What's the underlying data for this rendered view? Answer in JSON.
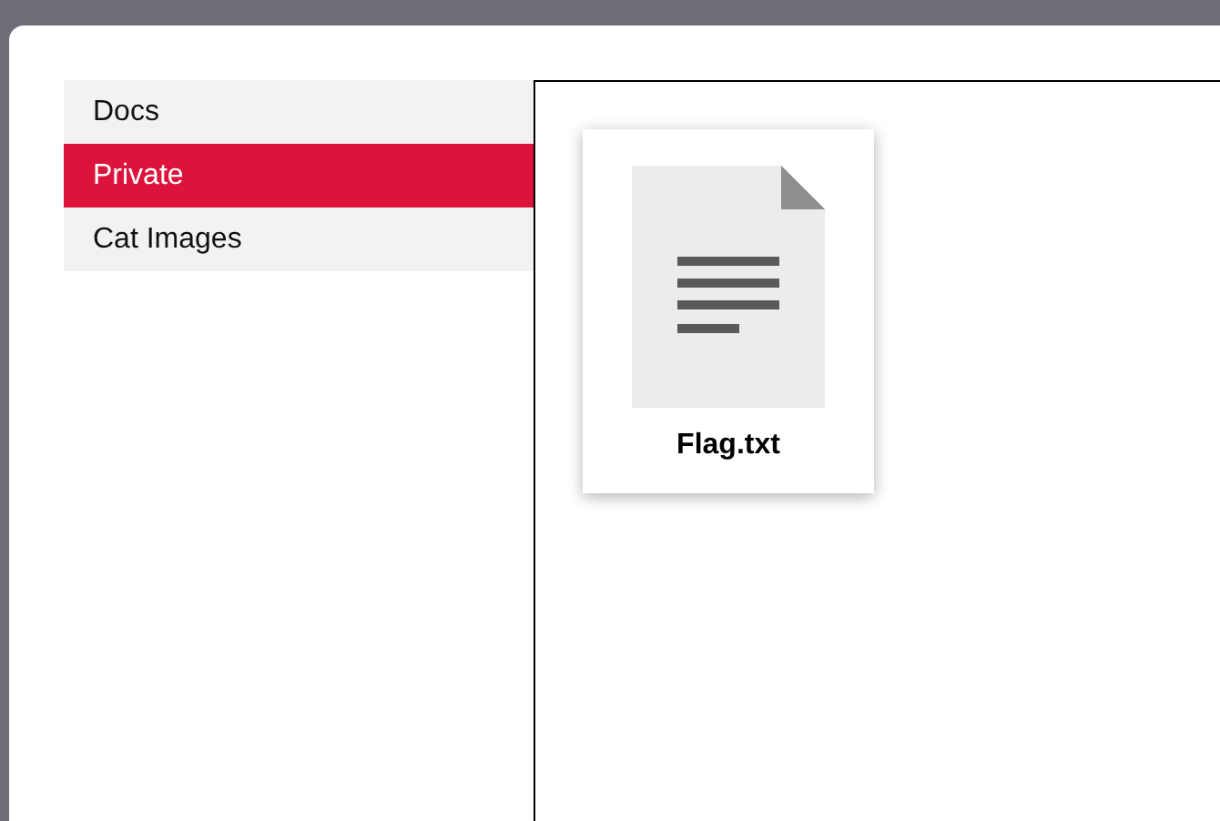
{
  "sidebar": {
    "items": [
      {
        "label": "Docs",
        "selected": false
      },
      {
        "label": "Private",
        "selected": true
      },
      {
        "label": "Cat Images",
        "selected": false
      }
    ]
  },
  "files": [
    {
      "name": "Flag.txt",
      "kind": "text"
    }
  ]
}
